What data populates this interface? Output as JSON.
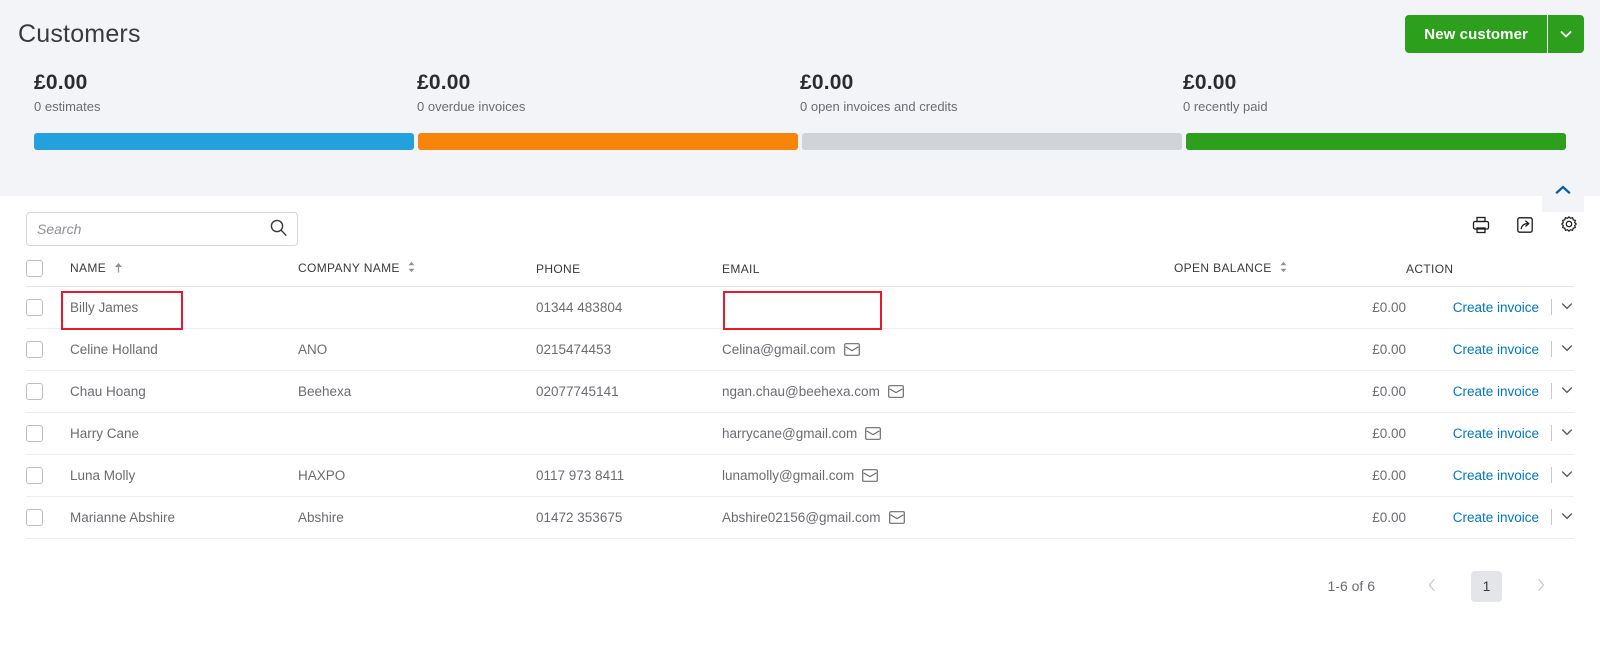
{
  "header": {
    "title": "Customers",
    "new_customer_label": "New customer",
    "accent_green": "#2ca01c"
  },
  "kpis": [
    {
      "amount": "£0.00",
      "label": "0 estimates",
      "color": "#24a0dd"
    },
    {
      "amount": "£0.00",
      "label": "0 overdue invoices",
      "color": "#f7840b"
    },
    {
      "amount": "£0.00",
      "label": "0 open invoices and credits",
      "color": "#d0d3d7"
    },
    {
      "amount": "£0.00",
      "label": "0 recently paid",
      "color": "#2ca01c"
    }
  ],
  "toolbar": {
    "search_placeholder": "Search",
    "search_value": "",
    "icons": [
      "print-icon",
      "export-icon",
      "gear-icon"
    ]
  },
  "table": {
    "columns": [
      {
        "label": "NAME",
        "sort": "asc"
      },
      {
        "label": "COMPANY NAME",
        "sort": "both"
      },
      {
        "label": "PHONE",
        "sort": "none"
      },
      {
        "label": "EMAIL",
        "sort": "none"
      },
      {
        "label": "OPEN BALANCE",
        "sort": "both"
      },
      {
        "label": "ACTION",
        "sort": "none"
      }
    ],
    "action_label": "Create invoice",
    "rows": [
      {
        "name": "Billy James",
        "company": "",
        "phone": "01344 483804",
        "email": "",
        "balance": "£0.00"
      },
      {
        "name": "Celine Holland",
        "company": "ANO",
        "phone": "0215474453",
        "email": "Celina@gmail.com",
        "balance": "£0.00"
      },
      {
        "name": "Chau Hoang",
        "company": "Beehexa",
        "phone": "02077745141",
        "email": "ngan.chau@beehexa.com",
        "balance": "£0.00"
      },
      {
        "name": "Harry Cane",
        "company": "",
        "phone": "",
        "email": "harrycane@gmail.com",
        "balance": "£0.00"
      },
      {
        "name": "Luna Molly",
        "company": "HAXPO",
        "phone": "0117 973 8411",
        "email": "lunamolly@gmail.com",
        "balance": "£0.00"
      },
      {
        "name": "Marianne Abshire",
        "company": "Abshire",
        "phone": "01472 353675",
        "email": "Abshire02156@gmail.com",
        "balance": "£0.00"
      }
    ]
  },
  "pagination": {
    "range_text": "1-6 of 6",
    "current_page": "1"
  },
  "annotations": {
    "highlight_color": "#e8192c"
  }
}
